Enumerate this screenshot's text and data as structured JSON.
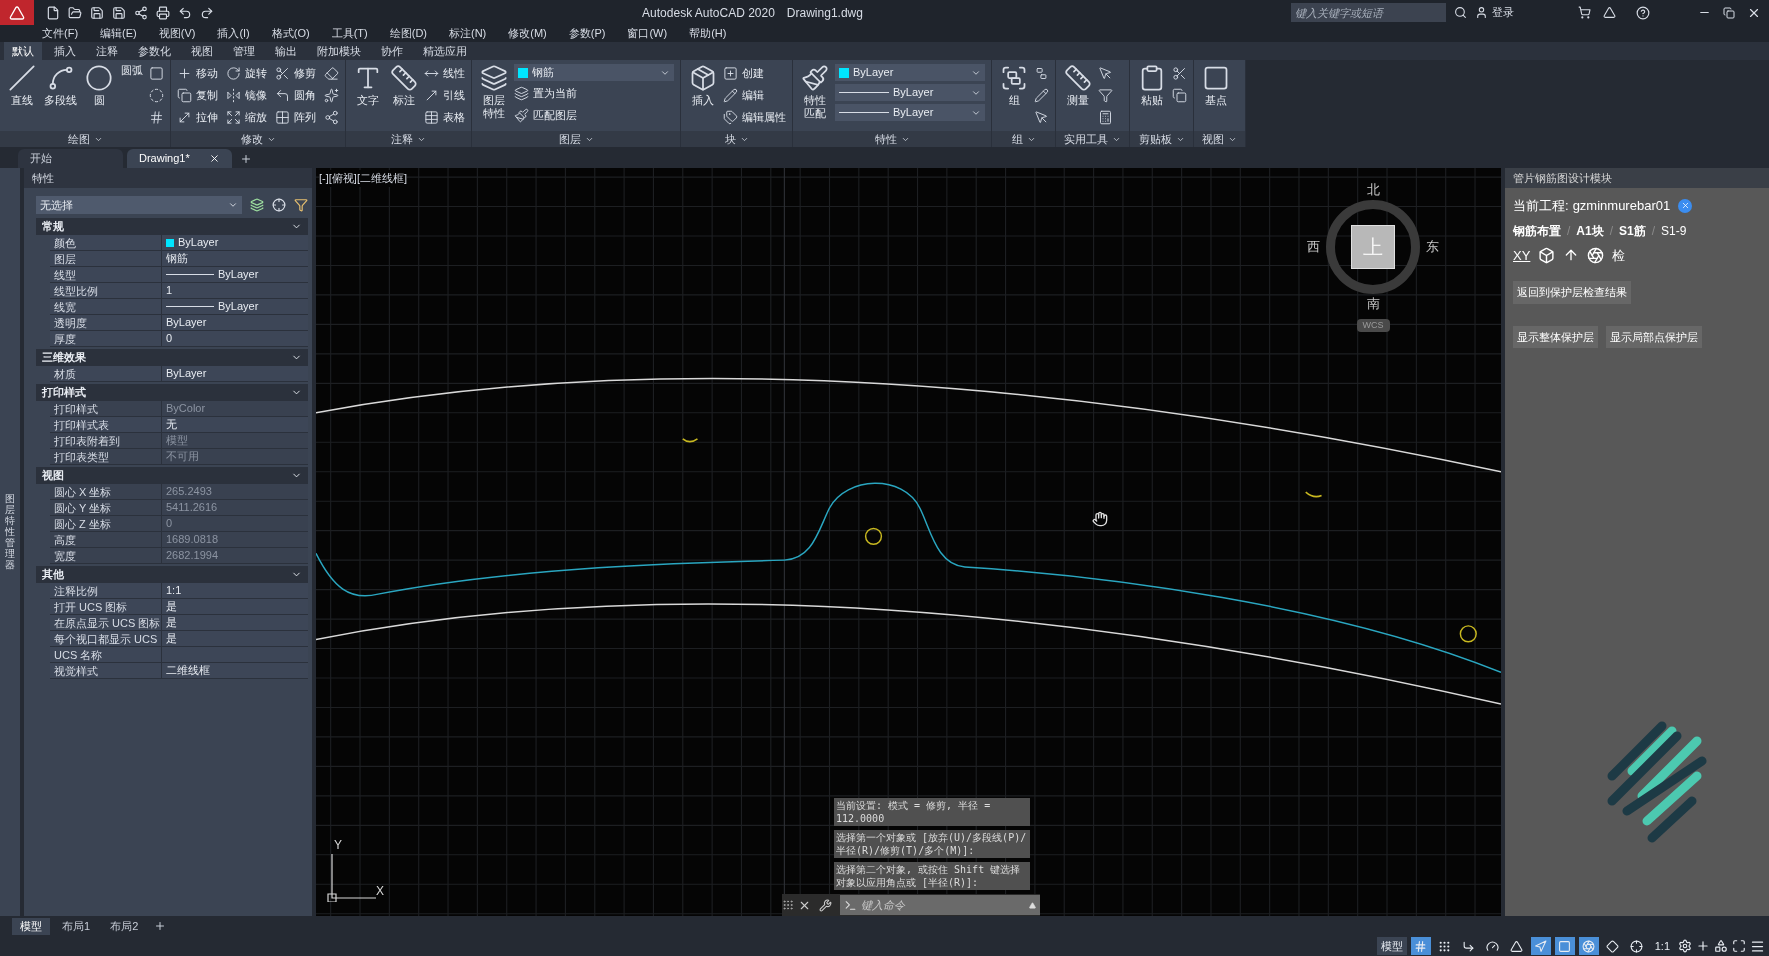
{
  "window": {
    "title": "Autodesk AutoCAD 2020",
    "file": "Drawing1.dwg",
    "search": {
      "placeholder": "键入关键字或短语"
    },
    "login": "登录"
  },
  "menu": [
    "文件(F)",
    "编辑(E)",
    "视图(V)",
    "插入(I)",
    "格式(O)",
    "工具(T)",
    "绘图(D)",
    "标注(N)",
    "修改(M)",
    "参数(P)",
    "窗口(W)",
    "帮助(H)"
  ],
  "ribbon_tabs": [
    {
      "label": "默认",
      "selected": true
    },
    {
      "label": "插入",
      "selected": false
    },
    {
      "label": "注释",
      "selected": false
    },
    {
      "label": "参数化",
      "selected": false
    },
    {
      "label": "视图",
      "selected": false
    },
    {
      "label": "管理",
      "selected": false
    },
    {
      "label": "输出",
      "selected": false
    },
    {
      "label": "附加模块",
      "selected": false
    },
    {
      "label": "协作",
      "selected": false
    },
    {
      "label": "精选应用",
      "selected": false
    }
  ],
  "ribbon_panels": [
    {
      "title": "绘图",
      "large_tools": [
        {
          "label": "直线",
          "kind": "line"
        },
        {
          "label": "多段线",
          "kind": "polyline"
        },
        {
          "label": "圆",
          "kind": "circle"
        },
        {
          "label": "圆弧",
          "kind": "arc"
        }
      ],
      "small_tools": [
        {
          "kind": "rectangle"
        },
        {
          "kind": "ellipse"
        },
        {
          "kind": "hatch"
        }
      ]
    },
    {
      "title": "修改",
      "small_tools": [
        {
          "label": "移动",
          "kind": "move"
        },
        {
          "label": "复制",
          "kind": "copy"
        },
        {
          "label": "拉伸",
          "kind": "stretch"
        },
        {
          "label": "旋转",
          "kind": "rotate"
        },
        {
          "label": "镜像",
          "kind": "mirror"
        },
        {
          "label": "缩放",
          "kind": "scale"
        },
        {
          "label": "修剪",
          "kind": "trim"
        },
        {
          "label": "圆角",
          "kind": "fillet"
        },
        {
          "label": "阵列",
          "kind": "array"
        },
        {
          "kind": "erase"
        },
        {
          "kind": "explode"
        },
        {
          "kind": "offset"
        }
      ]
    },
    {
      "title": "注释",
      "large_tools": [
        {
          "label": "文字",
          "kind": "text"
        },
        {
          "label": "标注",
          "kind": "dimension"
        }
      ],
      "small_tools": [
        {
          "label": "线性",
          "kind": "linear"
        },
        {
          "label": "引线",
          "kind": "leader"
        },
        {
          "label": "表格",
          "kind": "table"
        }
      ]
    },
    {
      "title": "图层",
      "dropdowns": [
        {
          "value": "钢筋",
          "color": "#00e5ff",
          "kind": "swatch"
        }
      ],
      "large_tools": [
        {
          "label": "图层特性",
          "kind": "layers"
        }
      ],
      "small_tools": [
        {
          "label": "置为当前",
          "kind": "layers"
        },
        {
          "label": "匹配图层",
          "kind": "match"
        }
      ]
    },
    {
      "title": "块",
      "large_tools": [
        {
          "label": "插入",
          "kind": "insert"
        }
      ],
      "small_tools": [
        {
          "label": "创建",
          "kind": "create"
        },
        {
          "label": "编辑",
          "kind": "edit"
        },
        {
          "label": "编辑属性",
          "kind": "attributes"
        }
      ]
    },
    {
      "title": "特性",
      "dropdowns": [
        {
          "value": "ByLayer",
          "color": "#00e5ff",
          "kind": "swatch"
        },
        {
          "value": "ByLayer",
          "kind": "line"
        },
        {
          "value": "ByLayer",
          "kind": "line"
        }
      ],
      "large_tools": [
        {
          "label": "特性匹配",
          "kind": "match"
        }
      ]
    },
    {
      "title": "组",
      "large_tools": [
        {
          "label": "组",
          "kind": "group"
        }
      ],
      "small_tools": [
        {
          "kind": "ungroup"
        },
        {
          "kind": "edit"
        },
        {
          "kind": "select"
        }
      ]
    },
    {
      "title": "实用工具",
      "large_tools": [
        {
          "label": "测量",
          "kind": "measure"
        }
      ],
      "small_tools": [
        {
          "kind": "select"
        },
        {
          "kind": "quickselect"
        },
        {
          "kind": "calculator"
        }
      ]
    },
    {
      "title": "剪贴板",
      "large_tools": [
        {
          "label": "粘贴",
          "kind": "paste"
        }
      ],
      "small_tools": [
        {
          "kind": "cut"
        },
        {
          "kind": "copy"
        }
      ]
    },
    {
      "title": "视图",
      "large_tools": [
        {
          "label": "基点",
          "kind": "basepoint"
        }
      ]
    }
  ],
  "file_tabs": [
    {
      "label": "开始",
      "selected": false,
      "closable": false
    },
    {
      "label": "Drawing1*",
      "selected": true,
      "closable": true
    }
  ],
  "side_strip": {
    "label": "图层特性管理器"
  },
  "properties_panel": {
    "title": "特性",
    "selection": "无选择",
    "sections": [
      {
        "title": "常规",
        "expanded": true,
        "rows": [
          {
            "label": "颜色",
            "value": "ByLayer",
            "kind": "swatch",
            "color": "#00e5ff",
            "disabled": false
          },
          {
            "label": "图层",
            "value": "钢筋",
            "kind": "text",
            "disabled": false
          },
          {
            "label": "线型",
            "value": "ByLayer",
            "kind": "line",
            "disabled": false
          },
          {
            "label": "线型比例",
            "value": "1",
            "kind": "text",
            "disabled": false
          },
          {
            "label": "线宽",
            "value": "ByLayer",
            "kind": "line",
            "disabled": false
          },
          {
            "label": "透明度",
            "value": "ByLayer",
            "kind": "text",
            "disabled": false
          },
          {
            "label": "厚度",
            "value": "0",
            "kind": "text",
            "disabled": false
          }
        ]
      },
      {
        "title": "三维效果",
        "expanded": true,
        "rows": [
          {
            "label": "材质",
            "value": "ByLayer",
            "kind": "text",
            "disabled": false
          }
        ]
      },
      {
        "title": "打印样式",
        "expanded": true,
        "rows": [
          {
            "label": "打印样式",
            "value": "ByColor",
            "kind": "text",
            "disabled": true
          },
          {
            "label": "打印样式表",
            "value": "无",
            "kind": "text",
            "disabled": false
          },
          {
            "label": "打印表附着到",
            "value": "模型",
            "kind": "text",
            "disabled": true
          },
          {
            "label": "打印表类型",
            "value": "不可用",
            "kind": "text",
            "disabled": true
          }
        ]
      },
      {
        "title": "视图",
        "expanded": true,
        "rows": [
          {
            "label": "圆心 X 坐标",
            "value": "265.2493",
            "kind": "text",
            "disabled": true
          },
          {
            "label": "圆心 Y 坐标",
            "value": "5411.2616",
            "kind": "text",
            "disabled": true
          },
          {
            "label": "圆心 Z 坐标",
            "value": "0",
            "kind": "text",
            "disabled": true
          },
          {
            "label": "高度",
            "value": "1689.0818",
            "kind": "text",
            "disabled": true
          },
          {
            "label": "宽度",
            "value": "2682.1994",
            "kind": "text",
            "disabled": true
          }
        ]
      },
      {
        "title": "其他",
        "expanded": true,
        "rows": [
          {
            "label": "注释比例",
            "value": "1:1",
            "kind": "text",
            "disabled": false
          },
          {
            "label": "打开 UCS 图标",
            "value": "是",
            "kind": "text",
            "disabled": false
          },
          {
            "label": "在原点显示 UCS 图标",
            "value": "是",
            "kind": "text",
            "disabled": false
          },
          {
            "label": "每个视口都显示 UCS",
            "value": "是",
            "kind": "text",
            "disabled": false
          },
          {
            "label": "UCS 名称",
            "kind": "text",
            "disabled": false
          },
          {
            "label": "视觉样式",
            "value": "二维线框",
            "kind": "text",
            "disabled": false
          }
        ]
      }
    ]
  },
  "viewport": {
    "label": "[-][俯视][二维线框]",
    "viewcube": {
      "north": "北",
      "south": "南",
      "east": "东",
      "west": "西",
      "top": "上",
      "ucs": "WCS"
    },
    "ucs_icon": {
      "x": "X",
      "y": "Y"
    }
  },
  "command_line": {
    "history": [
      "当前设置: 模式 = 修剪, 半径 = 112.0000",
      "选择第一个对象或 [放弃(U)/多段线(P)/半径(R)/修剪(T)/多个(M)]:",
      "选择第二个对象, 或按住 Shift 键选择对象以应用角点或 [半径(R)]:"
    ],
    "placeholder": "键入命令"
  },
  "design_panel": {
    "title": "管片钢筋图设计模块",
    "project_label": "当前工程:",
    "project": "gzminmurebar01",
    "breadcrumb": [
      {
        "kind": "crumb",
        "label": "钢筋布置",
        "bold": true
      },
      {
        "kind": "separator",
        "label": "/"
      },
      {
        "kind": "crumb",
        "label": "A1块",
        "bold": true
      },
      {
        "kind": "separator",
        "label": "/"
      },
      {
        "kind": "crumb",
        "label": "S1筋",
        "bold": true
      },
      {
        "kind": "separator",
        "label": "/"
      },
      {
        "kind": "crumb",
        "label": "S1-9",
        "bold": false
      }
    ],
    "xy_label": "XY",
    "check_label": "检",
    "buttons": [
      "返回到保护层检查结果",
      "显示整体保护层",
      "显示局部点保护层"
    ]
  },
  "layout_tabs": [
    {
      "label": "模型",
      "selected": true
    },
    {
      "label": "布局1",
      "selected": false
    },
    {
      "label": "布局2",
      "selected": false
    }
  ],
  "status_bar": {
    "model": "模型",
    "scale": "1:1",
    "toggles": [
      {
        "kind": "grid",
        "on": true
      },
      {
        "kind": "snap",
        "on": false
      },
      {
        "kind": "ortho",
        "on": false
      },
      {
        "kind": "polar",
        "on": false
      },
      {
        "kind": "isodraft",
        "on": false
      },
      {
        "kind": "tracking",
        "on": true
      },
      {
        "kind": "osnap",
        "on": true
      },
      {
        "kind": "annovisibility",
        "on": true
      },
      {
        "kind": "autoscale",
        "on": false
      },
      {
        "kind": "annoscale",
        "on": false
      }
    ]
  }
}
